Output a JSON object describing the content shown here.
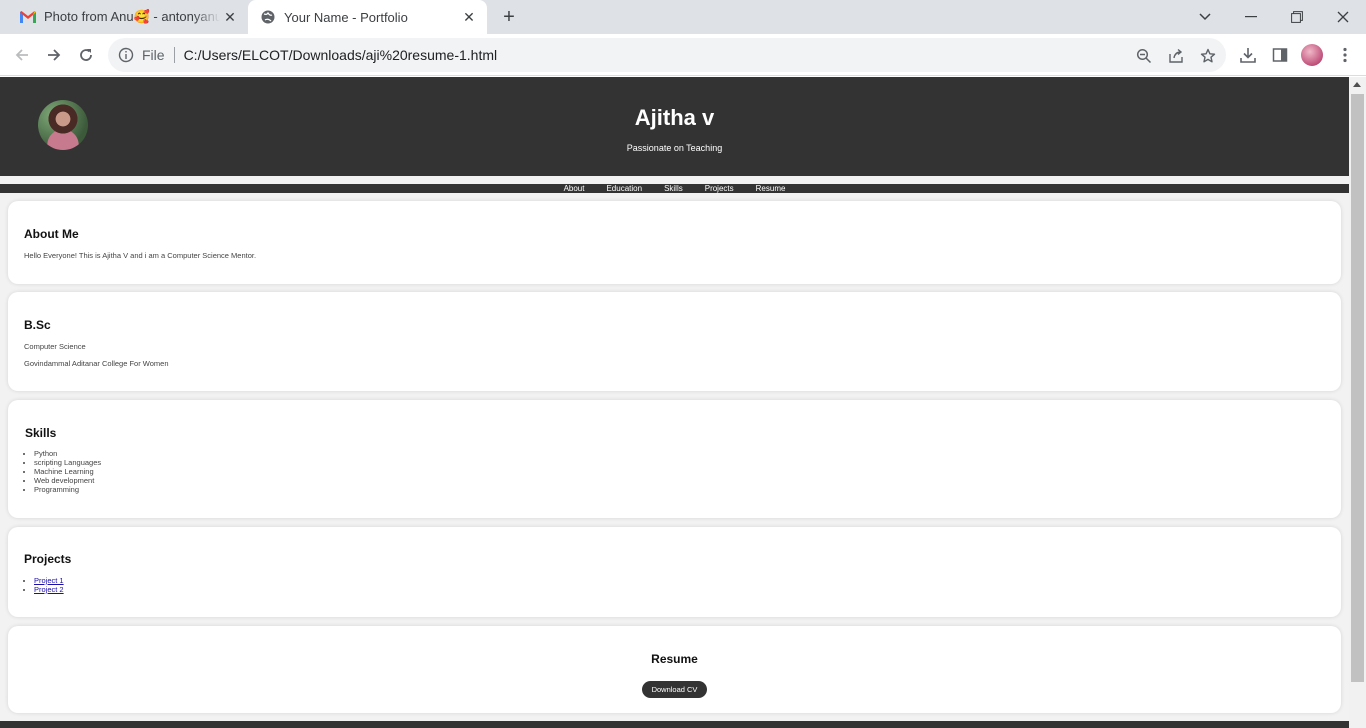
{
  "browser": {
    "tabs": [
      {
        "title": "Photo from Anu🥰 - antonyanu",
        "icon": "gmail-icon",
        "active": false
      },
      {
        "title": "Your Name - Portfolio",
        "icon": "globe-icon",
        "active": true
      }
    ],
    "new_tab_glyph": "+",
    "window_controls": {
      "dropdown": "⌄",
      "minimize": "—",
      "restore": "❐",
      "close": "✕"
    },
    "address_bar": {
      "scheme": "File",
      "url": "C:/Users/ELCOT/Downloads/aji%20resume-1.html"
    }
  },
  "site": {
    "name": "Ajitha v",
    "tagline": "Passionate on Teaching",
    "nav": [
      "About",
      "Education",
      "Skills",
      "Projects",
      "Resume"
    ],
    "about": {
      "heading": "About Me",
      "text": "Hello Everyone! This is Ajitha V and i am a Computer Science Mentor."
    },
    "education": {
      "heading": "B.Sc",
      "field": "Computer Science",
      "college": "Govindammal Aditanar College For Women"
    },
    "skills": {
      "heading": "Skills",
      "items": [
        "Python",
        "scripting Languages",
        "Machine Learning",
        "Web development",
        "Programming"
      ]
    },
    "projects": {
      "heading": "Projects",
      "items": [
        "Project 1",
        "Project 2"
      ]
    },
    "resume": {
      "heading": "Resume",
      "button": "Download CV"
    }
  },
  "colors": {
    "header_bg": "#333333",
    "page_bg": "#f2f2f2",
    "card_bg": "#ffffff",
    "tabbar_bg": "#dee1e6"
  }
}
